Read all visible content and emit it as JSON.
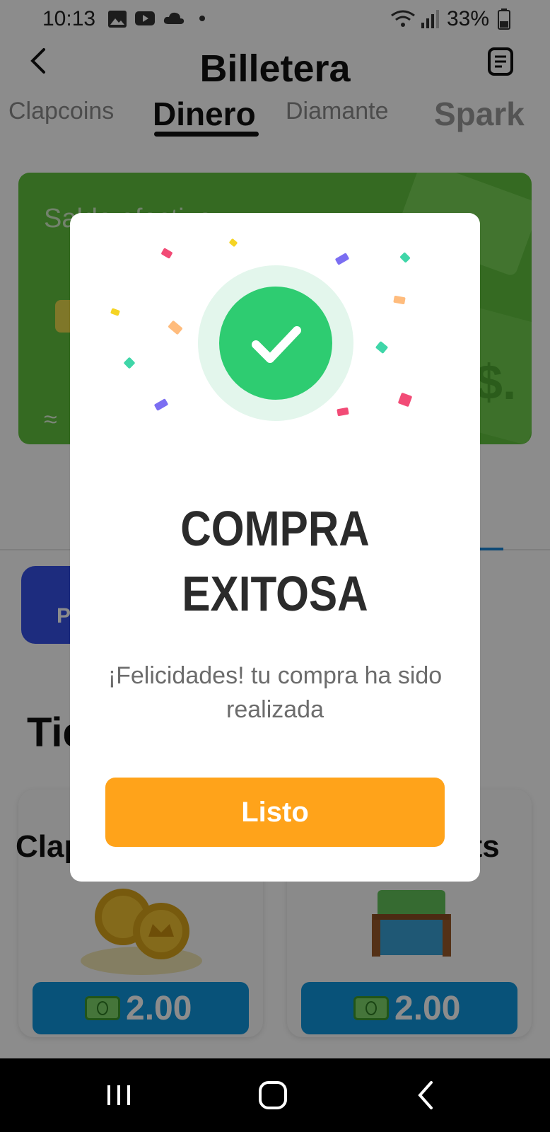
{
  "status_bar": {
    "time": "10:13",
    "battery": "33%",
    "icons": [
      "gallery-icon",
      "youtube-icon",
      "cloud-icon",
      "dot-icon",
      "wifi-icon",
      "signal-icon",
      "battery-icon"
    ]
  },
  "header": {
    "title": "Billetera",
    "back_icon": "chevron-left-icon",
    "history_icon": "document-icon"
  },
  "tabs": [
    {
      "label": "Clapcoins",
      "active": false
    },
    {
      "label": "Dinero",
      "active": true
    },
    {
      "label": "Diamante",
      "active": false
    },
    {
      "label": "Spark",
      "active": false
    }
  ],
  "balance_card": {
    "label": "Saldo efectivo",
    "approx": "≈"
  },
  "promo": {
    "text": "P"
  },
  "store": {
    "title": "Tienda",
    "products": [
      {
        "name": "Clapcoins",
        "price": "2.00",
        "image": "coins-icon"
      },
      {
        "name": "Chests",
        "price": "2.00",
        "image": "chest-icon"
      }
    ]
  },
  "modal": {
    "title_line1": "COMPRA",
    "title_line2": "EXITOSA",
    "message": "¡Felicidades! tu compra ha sido realizada",
    "button_label": "Listo",
    "icon": "check-icon"
  },
  "colors": {
    "accent_orange": "#ffa31a",
    "success_green": "#2ecc71",
    "card_green": "#62c23f",
    "price_blue": "#1096dd"
  }
}
